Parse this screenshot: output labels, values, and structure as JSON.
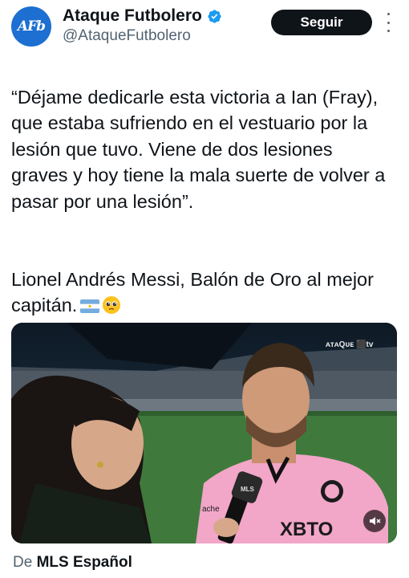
{
  "account": {
    "avatar_text": "AFb",
    "name": "Ataque Futbolero",
    "handle": "@AtaqueFutbolero",
    "verified": true
  },
  "follow_button": {
    "label": "Seguir"
  },
  "tweet": {
    "paragraph_1": "“Déjame dedicarle esta victoria a Ian (Fray), que estaba sufriendo en el vestuario por la lesión que tuvo. Viene de dos lesiones graves y hoy tiene la mala suerte de volver a pasar por una lesión”.",
    "paragraph_2": "Lionel Andrés Messi, Balón de Oro al mejor capitán.",
    "emojis": [
      "argentina-flag",
      "pleading-face"
    ]
  },
  "media": {
    "broadcast_logo": "ᴀᴛᴀQᴜᴇ ⬛tv",
    "jersey_sponsor": "XBTO",
    "mic_label": "MLS",
    "sleeve_text": "ache"
  },
  "source": {
    "prefix": "De",
    "name": "MLS Español"
  },
  "colors": {
    "accent": "#1d9bf0",
    "text": "#0f1419",
    "muted": "#536471",
    "jersey": "#f2a6c8"
  }
}
